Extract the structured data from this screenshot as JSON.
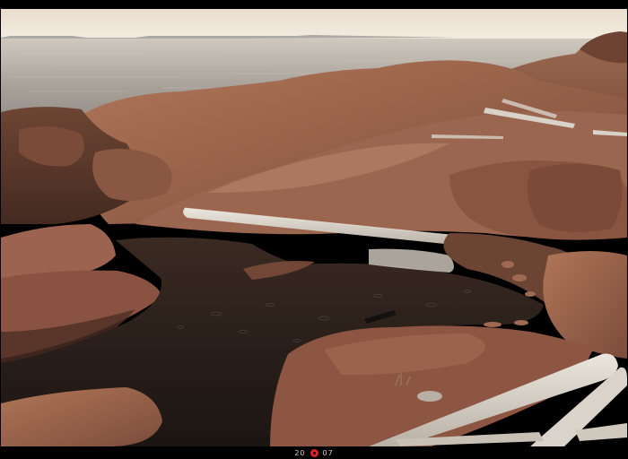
{
  "caption": {
    "year_left": "20",
    "year_right": "07",
    "mark_icon": "red-circle-logo-icon",
    "mark_color": "#d8242a"
  },
  "palette": {
    "sky": "#f0e6d8",
    "sea": "#b8b2aa",
    "rock_light": "#a87054",
    "rock_mid": "#8c5a44",
    "rock_dark": "#5e3a2c",
    "pool": "#2a211c",
    "driftwood": "#d8d2c8"
  }
}
